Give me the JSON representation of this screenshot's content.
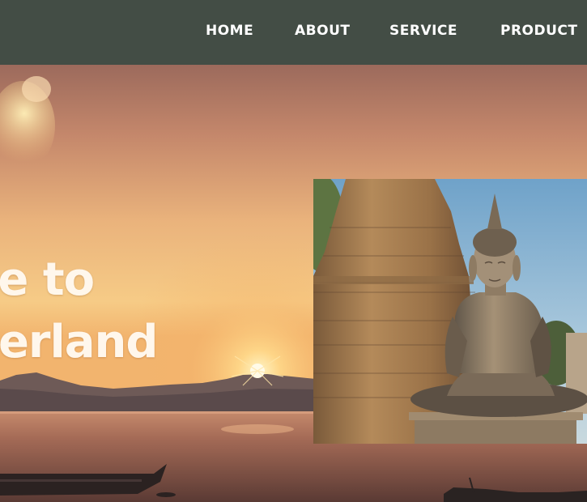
{
  "nav": {
    "items": [
      {
        "label": "HOME"
      },
      {
        "label": "ABOUT"
      },
      {
        "label": "SERVICE"
      },
      {
        "label": "PRODUCT"
      }
    ],
    "bg_color": "#434d45"
  },
  "hero": {
    "headline_line1": "me to",
    "headline_line2": "nderland",
    "headline_color": "#fff7ec"
  }
}
